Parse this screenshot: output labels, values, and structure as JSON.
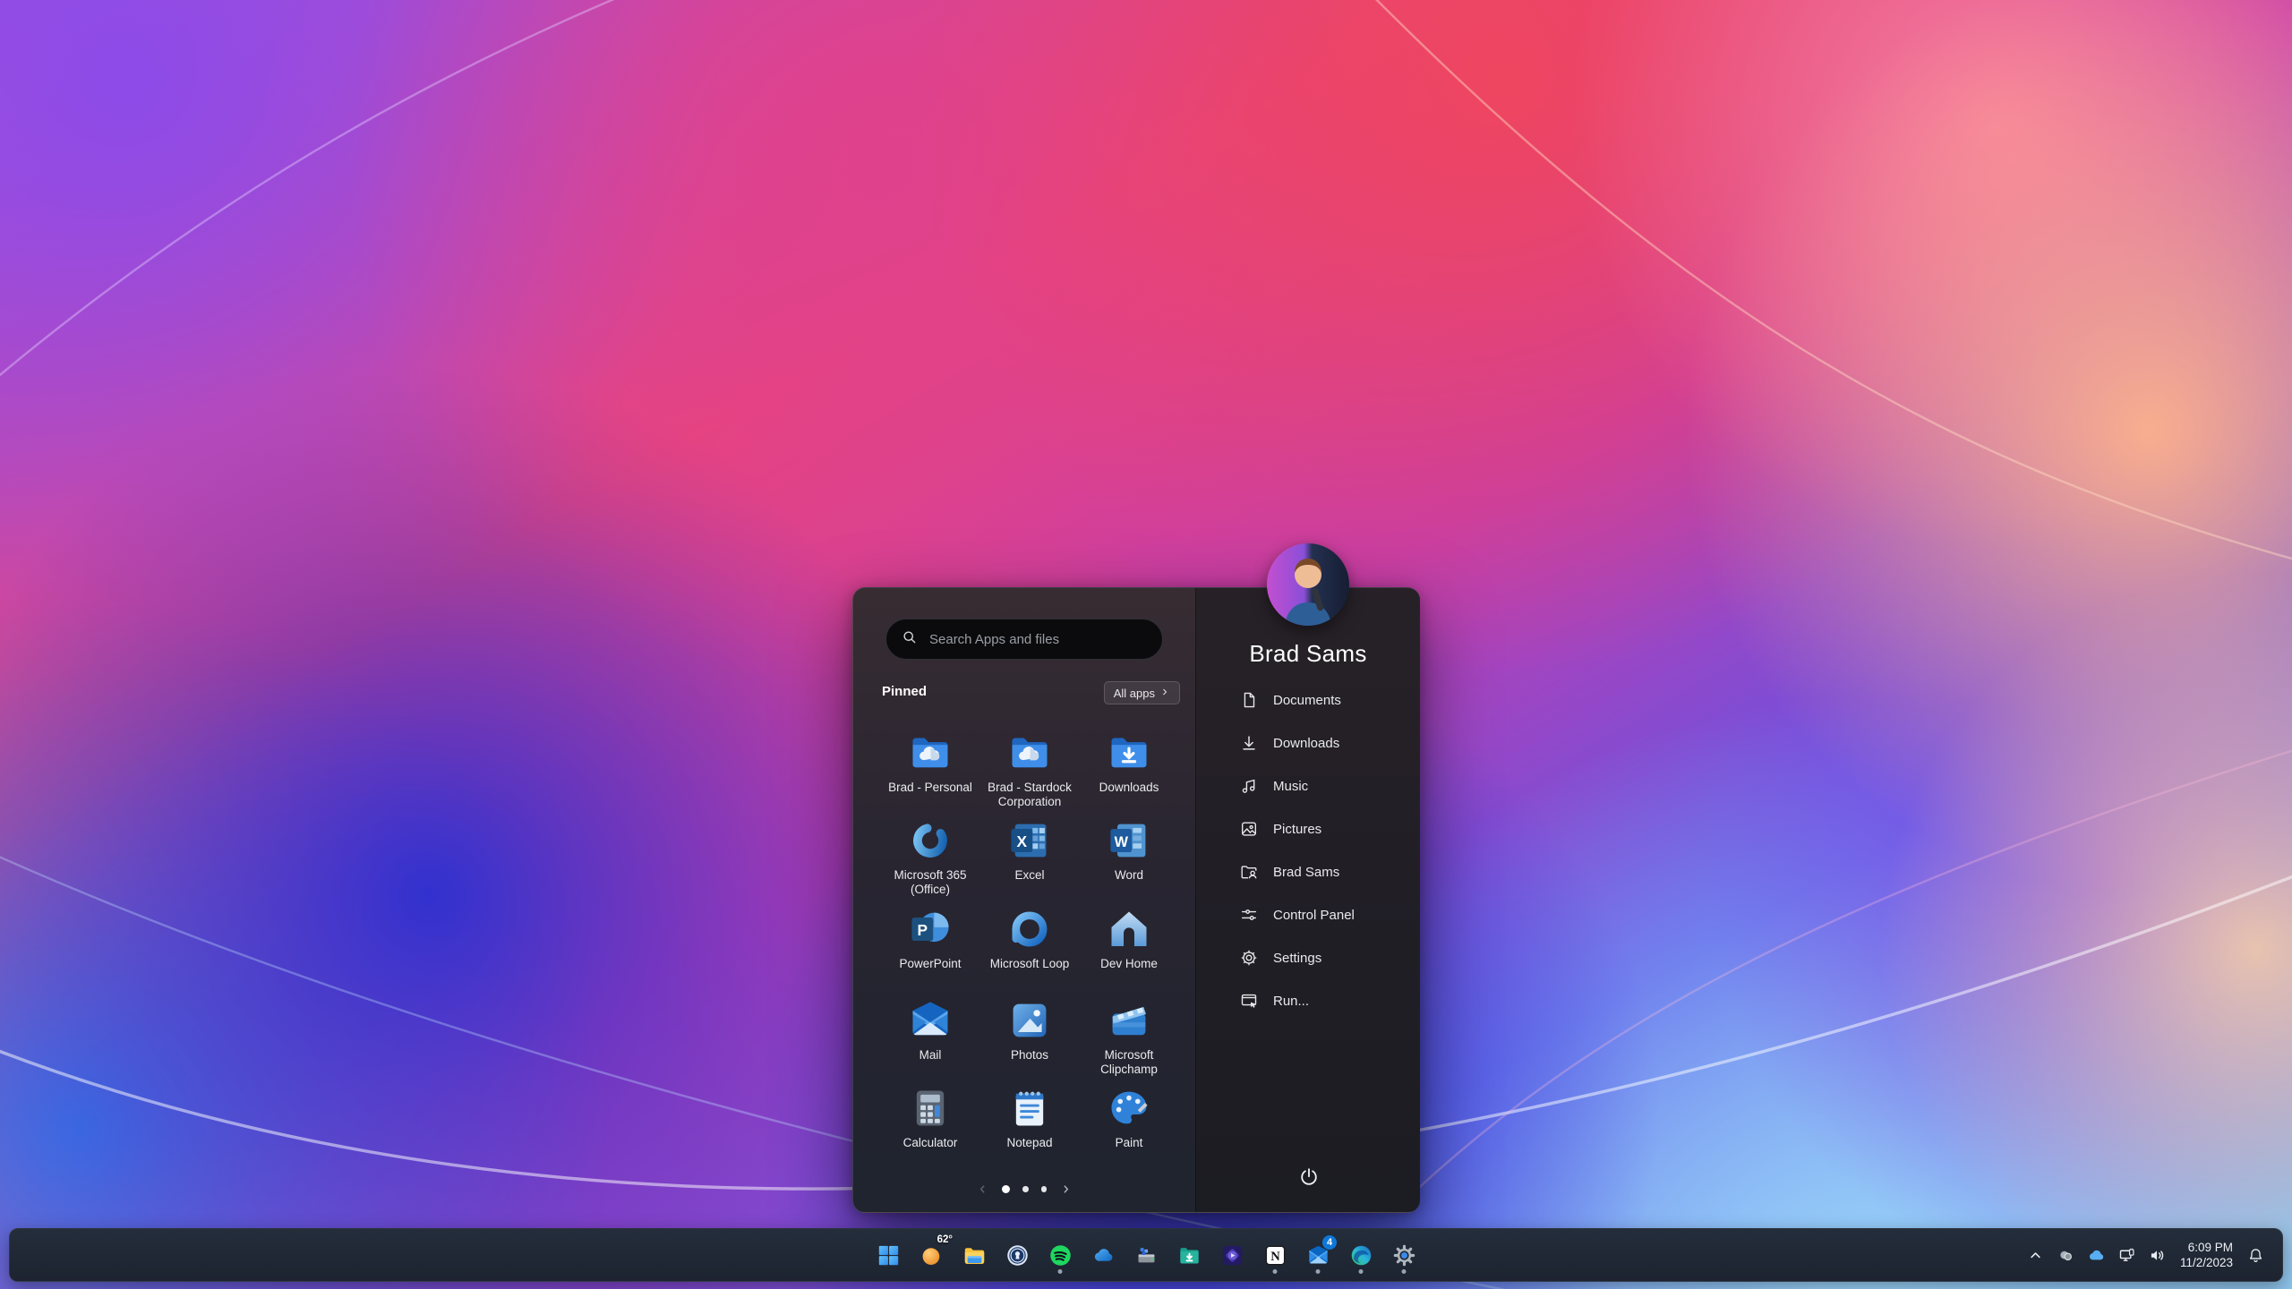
{
  "start_menu": {
    "search_placeholder": "Search Apps and files",
    "pinned_label": "Pinned",
    "all_apps_label": "All apps",
    "apps": [
      {
        "label": "Brad - Personal",
        "icon": "folder-cloud"
      },
      {
        "label": "Brad - Stardock Corporation",
        "icon": "folder-cloud"
      },
      {
        "label": "Downloads",
        "icon": "folder-download"
      },
      {
        "label": "Microsoft 365 (Office)",
        "icon": "m365"
      },
      {
        "label": "Excel",
        "icon": "excel"
      },
      {
        "label": "Word",
        "icon": "word"
      },
      {
        "label": "PowerPoint",
        "icon": "powerpoint"
      },
      {
        "label": "Microsoft Loop",
        "icon": "loop"
      },
      {
        "label": "Dev Home",
        "icon": "devhome"
      },
      {
        "label": "Mail",
        "icon": "mail"
      },
      {
        "label": "Photos",
        "icon": "photos"
      },
      {
        "label": "Microsoft Clipchamp",
        "icon": "clipchamp"
      },
      {
        "label": "Calculator",
        "icon": "calculator"
      },
      {
        "label": "Notepad",
        "icon": "notepad"
      },
      {
        "label": "Paint",
        "icon": "paint"
      }
    ],
    "pagination": {
      "pages": 3,
      "active_page": 1
    },
    "user_name": "Brad Sams",
    "sidebar_items": [
      {
        "label": "Documents",
        "icon": "doc"
      },
      {
        "label": "Downloads",
        "icon": "download"
      },
      {
        "label": "Music",
        "icon": "music"
      },
      {
        "label": "Pictures",
        "icon": "pictures"
      },
      {
        "label": "Brad Sams",
        "icon": "user-folder"
      },
      {
        "label": "Control Panel",
        "icon": "control-panel"
      },
      {
        "label": "Settings",
        "icon": "gear"
      },
      {
        "label": "Run...",
        "icon": "run"
      }
    ]
  },
  "taskbar": {
    "buttons": [
      {
        "name": "start",
        "icon": "windows",
        "running": false
      },
      {
        "name": "weather",
        "icon": "weather-moon",
        "running": false,
        "temp": "62°"
      },
      {
        "name": "file-explorer",
        "icon": "explorer",
        "running": false
      },
      {
        "name": "1password",
        "icon": "onepassword",
        "running": false
      },
      {
        "name": "spotify",
        "icon": "spotify",
        "running": true
      },
      {
        "name": "onedrive",
        "icon": "onedrive",
        "running": false
      },
      {
        "name": "storage-drive",
        "icon": "storage",
        "running": false
      },
      {
        "name": "downloads-folder",
        "icon": "folder-teal",
        "running": false
      },
      {
        "name": "movies-tv",
        "icon": "movies",
        "running": false
      },
      {
        "name": "notion",
        "icon": "notion",
        "running": true
      },
      {
        "name": "mail",
        "icon": "outlook",
        "running": true,
        "badge": "4"
      },
      {
        "name": "edge",
        "icon": "edge",
        "running": true
      },
      {
        "name": "settings",
        "icon": "settings-gear",
        "running": true
      }
    ],
    "tray": {
      "icons": [
        {
          "name": "hidden-icons",
          "icon": "chevron-up"
        },
        {
          "name": "background-app",
          "icon": "gray-circles"
        },
        {
          "name": "onedrive-status",
          "icon": "onedrive-small"
        },
        {
          "name": "network",
          "icon": "network"
        },
        {
          "name": "volume",
          "icon": "volume"
        }
      ],
      "time": "6:09 PM",
      "date": "11/2/2023"
    }
  },
  "colors": {
    "accent": "#0f78d7",
    "taskbar_bg": "#1d2430",
    "menu_bg": "#282531",
    "wallpaper_palette": [
      "#8d4be8",
      "#ee4560",
      "#e0418c",
      "#f8ae8e",
      "#3231cf",
      "#3d74e6",
      "#74b7ef",
      "#9ed9fa"
    ]
  }
}
